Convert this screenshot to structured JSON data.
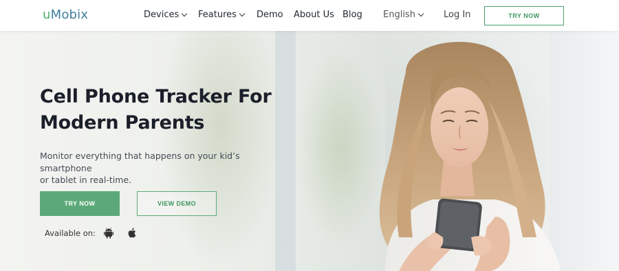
{
  "header": {
    "logo_prefix": "u",
    "logo_rest": "Mobix",
    "nav": {
      "devices": "Devices",
      "features": "Features",
      "demo": "Demo",
      "about": "About Us",
      "blog": "Blog",
      "language": "English",
      "login": "Log In"
    },
    "try_now": "TRY NOW"
  },
  "hero": {
    "headline_line1": "Cell Phone Tracker For",
    "headline_line2": "Modern Parents",
    "subtext_line1": "Monitor everything that happens on your kid’s smartphone",
    "subtext_line2": "or tablet in real-time.",
    "try_now": "TRY NOW",
    "view_demo": "VIEW DEMO",
    "available_on": "Available on:"
  },
  "colors": {
    "accent_green": "#5ba978",
    "logo_blue": "#3f7f9e",
    "text_dark": "#1b1f2a"
  },
  "icons": {
    "platform_1": "android-icon",
    "platform_2": "apple-icon"
  }
}
